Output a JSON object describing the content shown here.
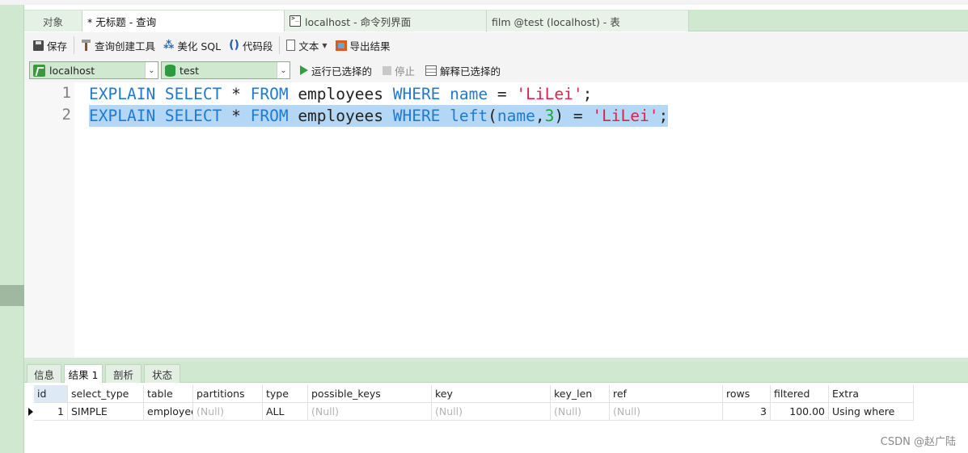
{
  "tabs": [
    {
      "label": "对象"
    },
    {
      "label": "* 无标题 - 查询"
    },
    {
      "label": "localhost - 命令列界面"
    },
    {
      "label": "film @test (localhost) - 表"
    }
  ],
  "toolbar": {
    "save": "保存",
    "query_builder": "查询创建工具",
    "beautify": "美化 SQL",
    "snippet": "代码段",
    "text": "文本",
    "export": "导出结果"
  },
  "connection": {
    "server": "localhost",
    "database": "test",
    "run_selected": "运行已选择的",
    "stop": "停止",
    "explain_selected": "解释已选择的"
  },
  "editor": {
    "line_numbers": [
      "1",
      "2"
    ],
    "lines": [
      {
        "selected": false,
        "tokens": [
          {
            "t": "EXPLAIN SELECT",
            "c": "kw"
          },
          {
            "t": " * ",
            "c": ""
          },
          {
            "t": "FROM",
            "c": "kw"
          },
          {
            "t": " employees ",
            "c": ""
          },
          {
            "t": "WHERE",
            "c": "kw"
          },
          {
            "t": " ",
            "c": ""
          },
          {
            "t": "name",
            "c": "kw"
          },
          {
            "t": " = ",
            "c": ""
          },
          {
            "t": "'LiLei'",
            "c": "str"
          },
          {
            "t": ";",
            "c": ""
          }
        ]
      },
      {
        "selected": true,
        "tokens": [
          {
            "t": "EXPLAIN SELECT",
            "c": "kw"
          },
          {
            "t": " * ",
            "c": ""
          },
          {
            "t": "FROM",
            "c": "kw"
          },
          {
            "t": " employees ",
            "c": ""
          },
          {
            "t": "WHERE",
            "c": "kw"
          },
          {
            "t": " ",
            "c": ""
          },
          {
            "t": "left",
            "c": "kw"
          },
          {
            "t": "(",
            "c": ""
          },
          {
            "t": "name",
            "c": "kw"
          },
          {
            "t": ",",
            "c": ""
          },
          {
            "t": "3",
            "c": "num"
          },
          {
            "t": ") = ",
            "c": ""
          },
          {
            "t": "'LiLei'",
            "c": "str"
          },
          {
            "t": ";",
            "c": ""
          }
        ]
      }
    ]
  },
  "result_tabs": [
    {
      "label": "信息"
    },
    {
      "label": "结果 1"
    },
    {
      "label": "剖析"
    },
    {
      "label": "状态"
    }
  ],
  "result_table": {
    "columns": [
      "id",
      "select_type",
      "table",
      "partitions",
      "type",
      "possible_keys",
      "key",
      "key_len",
      "ref",
      "rows",
      "filtered",
      "Extra"
    ],
    "rows": [
      [
        "1",
        "SIMPLE",
        "employee",
        "(Null)",
        "ALL",
        "(Null)",
        "(Null)",
        "(Null)",
        "(Null)",
        "3",
        "100.00",
        "Using where"
      ]
    ]
  },
  "watermark": "CSDN @赵广陆"
}
